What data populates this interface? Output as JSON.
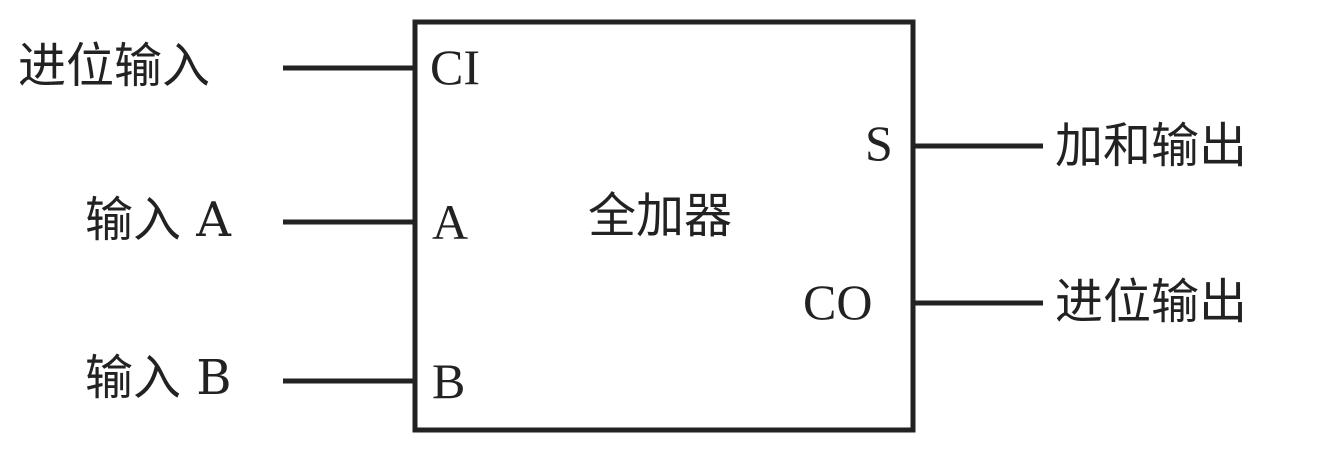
{
  "block": {
    "title": "全加器"
  },
  "inputs": [
    {
      "label": "进位输入",
      "pin": "CI"
    },
    {
      "label": "输入 A",
      "pin": "A"
    },
    {
      "label": "输入 B",
      "pin": "B"
    }
  ],
  "outputs": [
    {
      "label": "加和输出",
      "pin": "S"
    },
    {
      "label": "进位输出",
      "pin": "CO"
    }
  ]
}
